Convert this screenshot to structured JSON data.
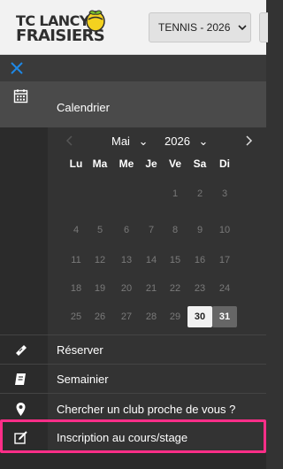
{
  "header": {
    "logo_line1": "TC LANCY",
    "logo_line2": "FRAISIERS",
    "season_label": "TENNIS - 2026"
  },
  "nav": {
    "calendar_label": "Calendrier",
    "reserve_label": "Réserver",
    "weekly_label": "Semainier",
    "club_search_label": "Chercher un club proche de vous ?",
    "inscription_label": "Inscription au cours/stage"
  },
  "calendar": {
    "month_label": "Mai",
    "year_label": "2026",
    "weekdays": [
      "Lu",
      "Ma",
      "Me",
      "Je",
      "Ve",
      "Sa",
      "Di"
    ],
    "weeks": [
      [
        "",
        "",
        "",
        "",
        "1",
        "2",
        "3"
      ],
      [
        "4",
        "5",
        "6",
        "7",
        "8",
        "9",
        "10"
      ],
      [
        "11",
        "12",
        "13",
        "14",
        "15",
        "16",
        "17"
      ],
      [
        "18",
        "19",
        "20",
        "21",
        "22",
        "23",
        "24"
      ],
      [
        "25",
        "26",
        "27",
        "28",
        "29",
        "30",
        "31"
      ]
    ],
    "selected_day": "30",
    "highlight_day": "31"
  },
  "colors": {
    "highlight_border": "#ff2e88",
    "accent_blue": "#1e88e5",
    "fruit_yellow": "#f4d21f",
    "fruit_leaf": "#7abf2a"
  }
}
